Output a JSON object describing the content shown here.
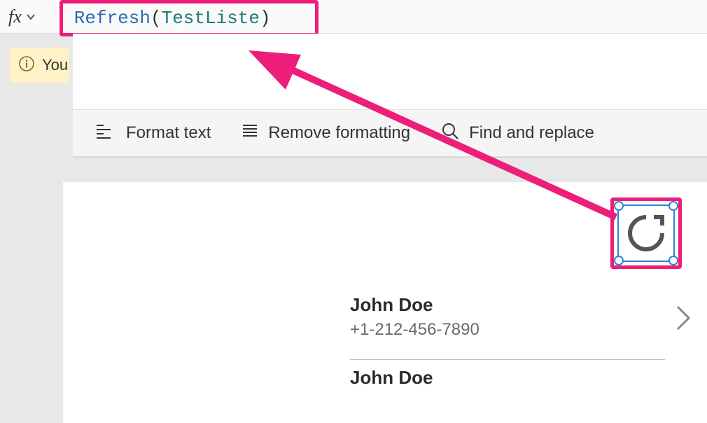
{
  "formula_bar": {
    "fx": "fx",
    "function": "Refresh",
    "open_paren": "(",
    "argument": "TestListe",
    "close_paren": ")"
  },
  "info": {
    "text": "You"
  },
  "toolbar": {
    "format_text": "Format text",
    "remove_formatting": "Remove formatting",
    "find_replace": "Find and replace"
  },
  "list": {
    "items": [
      {
        "title": "John Doe",
        "subtitle": "+1-212-456-7890"
      },
      {
        "title": "John Doe",
        "subtitle": ""
      }
    ]
  },
  "annotations": {
    "highlight_color": "#ed1e79"
  }
}
